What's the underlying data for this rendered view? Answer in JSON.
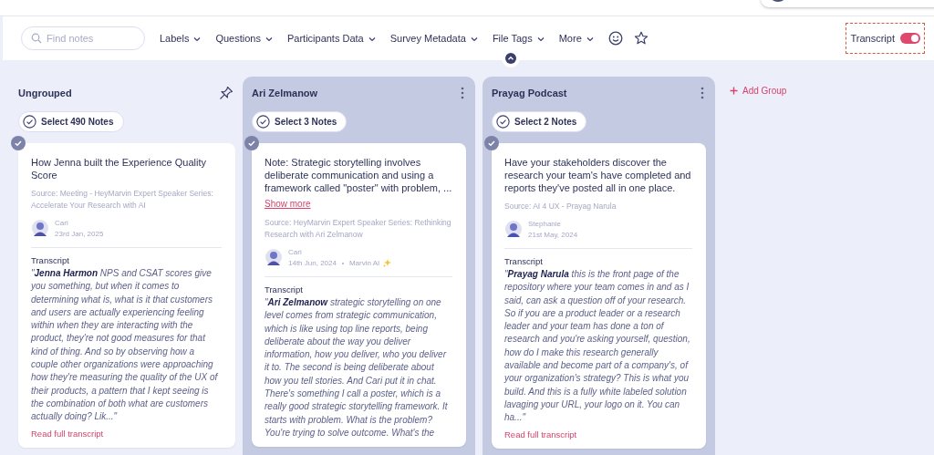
{
  "toolbar": {
    "search": {
      "placeholder": "Find notes"
    },
    "filters": [
      "Labels",
      "Questions",
      "Participants Data",
      "Survey Metadata",
      "File Tags",
      "More"
    ],
    "transcript_toggle": {
      "label": "Transcript",
      "on": true
    }
  },
  "groups": [
    {
      "title": "Ungrouped",
      "kind": "ungrouped",
      "select_label": "Select 490 Notes",
      "notes": [
        {
          "checked": true,
          "title": "How Jenna built the Experience Quality Score",
          "source": "Source: Meeting - HeyMarvin Expert Speaker Series: Accelerate Your Research with AI",
          "author": "Cari",
          "date": "23rd Jan, 2025",
          "transcript_label": "Transcript",
          "transcript": "\"**Jenna Harmon** NPS and CSAT scores give you something, but when it comes to determining what is, what is it that customers and users are actually experiencing feeling within when they are interacting with the product, they're not good measures for that kind of thing. And so by observing how a couple other organizations were approaching how they're measuring the quality of the UX of their products, a pattern that I kept seeing is the combination of both what are customers actually doing? Lik...\"",
          "read_more": "Read full transcript"
        }
      ]
    },
    {
      "title": "Ari Zelmanow",
      "kind": "group",
      "select_label": "Select 3 Notes",
      "notes": [
        {
          "checked": true,
          "title": "Note: Strategic storytelling involves deliberate communication and using a framework called \"poster\" with problem, ...",
          "show_more": "Show more",
          "source": "Source: HeyMarvin Expert Speaker Series: Rethinking Research with Ari Zelmanow",
          "author": "Cari",
          "date": "14th Jun, 2024",
          "ai_label": "Marvin AI",
          "transcript_label": "Transcript",
          "transcript": "\"**Ari Zelmanow** strategic storytelling on one level comes from strategic communication, which is like using top line reports, being deliberate about the way you deliver information, how you deliver, who you deliver it to. The second is being deliberate about how you tell stories. And Cari put it in chat. There's something I call a poster, which is a really good strategic storytelling framework. It starts with problem. What is the problem? You're trying to solve outcome. What's the"
        }
      ]
    },
    {
      "title": "Prayag Podcast",
      "kind": "group",
      "select_label": "Select 2 Notes",
      "notes": [
        {
          "checked": true,
          "title": "Have your stakeholders discover the research your team's have completed and reports they've posted all in one place.",
          "source": "Source: AI 4 UX - Prayag Narula",
          "author": "Stephanie",
          "date": "21st May, 2024",
          "transcript_label": "Transcript",
          "transcript": "\"**Prayag Narula** this is the front page of the repository where your team comes in and as I said, can ask a question off of your research. So if you are a product leader or a research leader and your team has done a ton of research and you're asking yourself, question, how do I make this research generally available and become part of a company's, of your organization's strategy? This is what you build. And this is a fully white labeled solution lavaging your URL, your logo on it. You can ha...\"",
          "read_more": "Read full transcript"
        }
      ]
    }
  ],
  "add_group": "Add Group"
}
